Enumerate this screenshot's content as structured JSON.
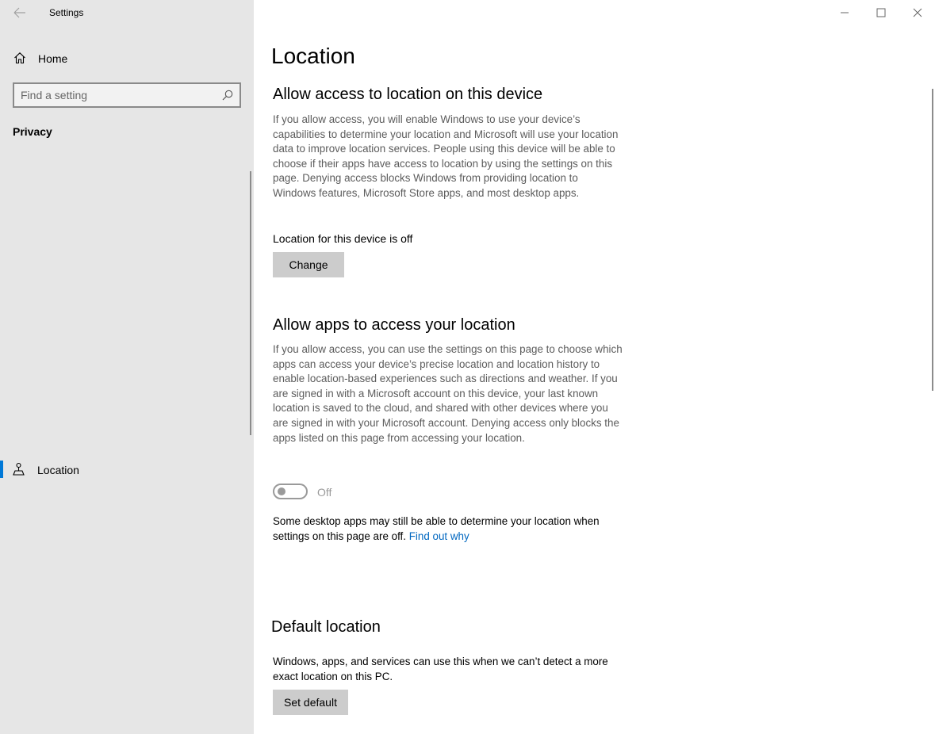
{
  "window": {
    "title": "Settings",
    "controls": [
      "minimize",
      "maximize",
      "close"
    ]
  },
  "sidebar": {
    "home_label": "Home",
    "search_placeholder": "Find a setting",
    "section_title": "Privacy",
    "items": [
      {
        "label": "Location",
        "icon": "location-icon",
        "selected": true
      }
    ]
  },
  "main": {
    "title": "Location",
    "device_section": {
      "heading": "Allow access to location on this device",
      "description": "If you allow access, you will enable Windows to use your device’s capabilities to determine your location and Microsoft will use your location data to improve location services. People using this device will be able to choose if their apps have access to location by using the settings on this page. Denying access blocks Windows from providing location to Windows features, Microsoft Store apps, and most desktop apps.",
      "status": "Location for this device is off",
      "button_label": "Change"
    },
    "apps_section": {
      "heading": "Allow apps to access your location",
      "description": "If you allow access, you can use the settings on this page to choose which apps can access your device’s precise location and location history to enable location-based experiences such as directions and weather. If you are signed in with a Microsoft account on this device, your last known location is saved to the cloud, and shared with other devices where you are signed in with your Microsoft account. Denying access only blocks the apps listed on this page from accessing your location.",
      "toggle_state": "Off",
      "toggle_on": false,
      "note": "Some desktop apps may still be able to determine your location when settings on this page are off.",
      "link_label": "Find out why"
    },
    "default_section": {
      "heading": "Default location",
      "description": "Windows, apps, and services can use this when we can’t detect a more exact location on this PC.",
      "button_label": "Set default"
    }
  },
  "colors": {
    "accent": "#0078d7",
    "link": "#0067c0",
    "sidebar_bg": "#e6e6e6",
    "button_bg": "#cccccc"
  }
}
